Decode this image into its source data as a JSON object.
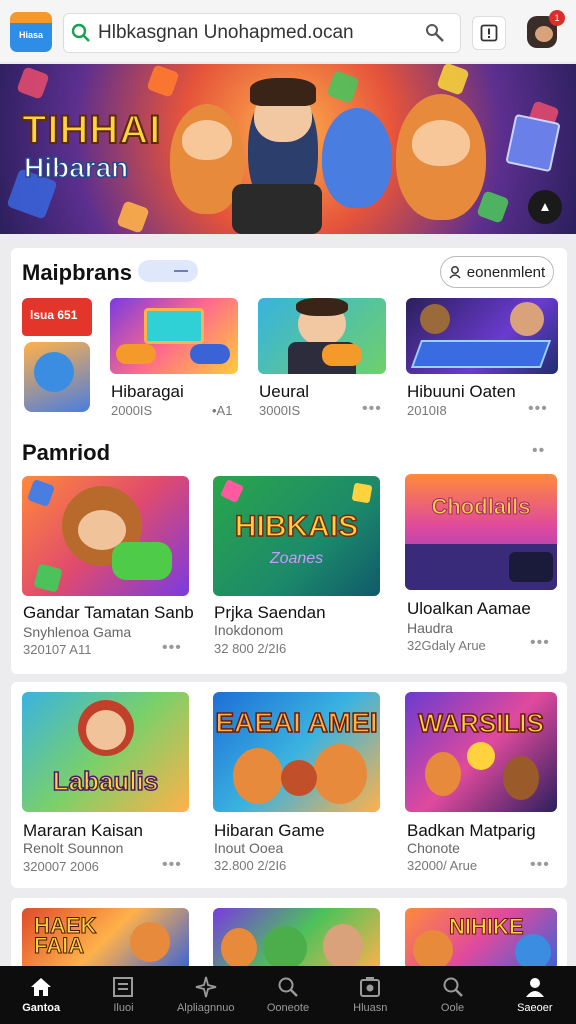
{
  "header": {
    "logo_text": "Hiasa",
    "search_value": "Hlbkasgnan Unohapmed.ocan",
    "badge_count": "1"
  },
  "hero": {
    "title": "TIHHAI",
    "subtitle": "Hibaran"
  },
  "section1": {
    "title": "Maipbrans",
    "button_label": "eonenmlent",
    "items": [
      {
        "name": "",
        "sub": "",
        "promo": "lsua 651"
      },
      {
        "name": "Hibaragai",
        "sub": "2000IS",
        "meta": "•A1"
      },
      {
        "name": "Ueural",
        "sub": "3000IS"
      },
      {
        "name": "Hibuuni Oaten",
        "sub": "2010I8"
      }
    ]
  },
  "section2": {
    "title": "Pamriod",
    "items": [
      {
        "name": "Gandar Tamatan Sanb",
        "sub": "Snyhlenoa Gama",
        "meta": "320107 A11",
        "art": "",
        "art2": ""
      },
      {
        "name": "Prjka Saendan",
        "sub": "Inokdonom",
        "meta": "32 800 2/2I6",
        "art": "HIBKAIS",
        "art2": "Zoanes"
      },
      {
        "name": "Uloalkan Aamae",
        "sub": "Haudra",
        "meta": "32Gdaly Arue",
        "art": "Chodlails",
        "art2": ""
      }
    ]
  },
  "section3": {
    "items": [
      {
        "name": "Mararan Kaisan",
        "sub": "Renolt Sounnon",
        "meta": "320007 2006",
        "art": "Labaulis"
      },
      {
        "name": "Hibaran Game",
        "sub": "Inout Ooea",
        "meta": "32.800 2/2I6",
        "art": "EAEAI AMEI"
      },
      {
        "name": "Badkan Matparig",
        "sub": "Chonote",
        "meta": "32000/ Arue",
        "art": "WARSILIS"
      }
    ]
  },
  "section4": {
    "items": [
      {
        "art": "HAEK FAIA"
      },
      {
        "art": ""
      },
      {
        "art": "NIHIKE"
      }
    ]
  },
  "nav": [
    {
      "label": "Gantoa",
      "icon": "home-icon"
    },
    {
      "label": "Iluoi",
      "icon": "library-icon"
    },
    {
      "label": "Alpliagnnuo",
      "icon": "sparkle-icon"
    },
    {
      "label": "Ooneote",
      "icon": "search-icon"
    },
    {
      "label": "Hluasn",
      "icon": "games-icon"
    },
    {
      "label": "Oole",
      "icon": "zoom-icon"
    },
    {
      "label": "Saeoer",
      "icon": "profile-icon"
    }
  ],
  "colors": {
    "accent": "#2e8de6",
    "nav_bg": "#0d0d0d",
    "hero_title": "#ffd23e"
  }
}
